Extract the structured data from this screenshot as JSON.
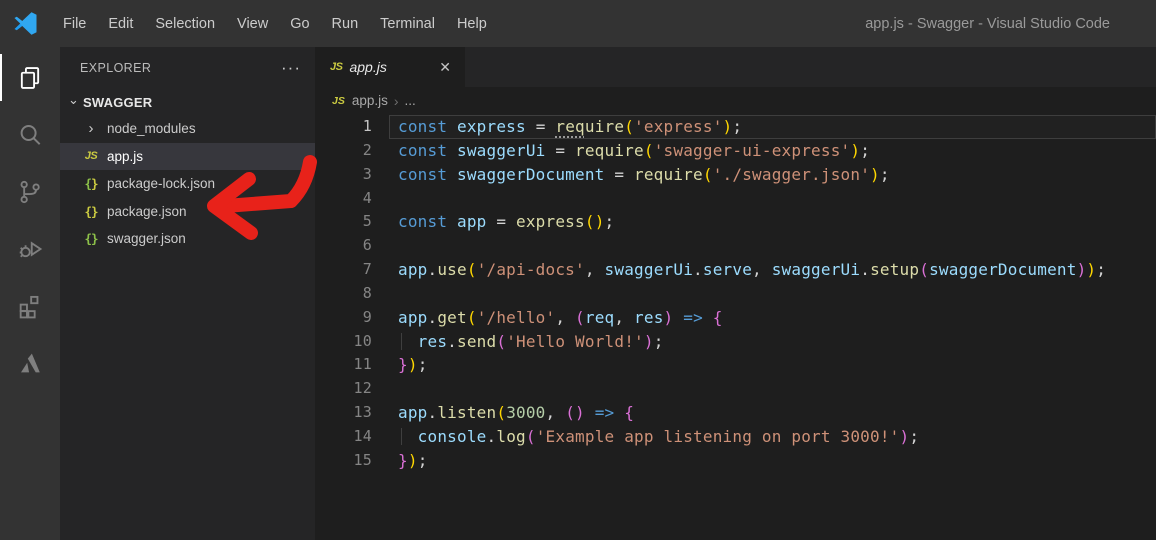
{
  "colors": {
    "titlebar_bg": "#333333",
    "activitybar_bg": "#333333",
    "sidebar_bg": "#252526",
    "editor_bg": "#1e1e1e",
    "tab_strip_bg": "#252526",
    "selected_row_bg": "#37373d",
    "logo_blue": "#1f9cf0",
    "arrow_red": "#e8221a",
    "syntax": {
      "keyword": "#569cd6",
      "variable": "#9cdcfe",
      "function": "#dcdcaa",
      "string": "#ce9178",
      "number": "#b5cea8",
      "plain": "#d4d4d4",
      "bracket1": "#ffd700",
      "bracket2": "#da70d6"
    }
  },
  "title_bar": {
    "menu_items": [
      "File",
      "Edit",
      "Selection",
      "View",
      "Go",
      "Run",
      "Terminal",
      "Help"
    ],
    "window_title": "app.js - Swagger - Visual Studio Code"
  },
  "activity_bar": {
    "icons": [
      {
        "name": "explorer",
        "active": true
      },
      {
        "name": "search",
        "active": false
      },
      {
        "name": "source-control",
        "active": false
      },
      {
        "name": "run-debug",
        "active": false
      },
      {
        "name": "extensions",
        "active": false
      },
      {
        "name": "azure",
        "active": false
      }
    ]
  },
  "sidebar": {
    "header": "EXPLORER",
    "header_actions": "···",
    "section": {
      "chevron": "⌄",
      "label": "SWAGGER"
    },
    "files": [
      {
        "icon": "chevron",
        "label": "node_modules",
        "selected": false
      },
      {
        "icon": "js",
        "icon_text": "JS",
        "label": "app.js",
        "selected": true
      },
      {
        "icon": "braces",
        "open_color": "#8dc149",
        "close_color": "#cbcb41",
        "label": "package-lock.json",
        "selected": false
      },
      {
        "icon": "braces",
        "open_color": "#cbcb41",
        "close_color": "#cbcb41",
        "label": "package.json",
        "selected": false
      },
      {
        "icon": "braces",
        "open_color": "#8dc149",
        "close_color": "#8dc149",
        "label": "swagger.json",
        "selected": false
      }
    ]
  },
  "annotation": {
    "type": "red-arrow",
    "points_at": "app.js",
    "color": "#e8221a"
  },
  "editor": {
    "tab": {
      "icon_text": "JS",
      "label": "app.js",
      "close": "✕"
    },
    "breadcrumb": {
      "icon_text": "JS",
      "file": "app.js",
      "separator": "›",
      "rest": "..."
    }
  },
  "code": {
    "current_line": 1,
    "lines": [
      {
        "num": 1,
        "tokens": [
          [
            "kw",
            "const"
          ],
          [
            "pl",
            " "
          ],
          [
            "var",
            "express"
          ],
          [
            "pl",
            " = "
          ],
          [
            "fnd",
            "req"
          ],
          [
            "fn",
            "uire"
          ],
          [
            "b1",
            "("
          ],
          [
            "str",
            "'express'"
          ],
          [
            "b1",
            ")"
          ],
          [
            "pl",
            ";"
          ]
        ]
      },
      {
        "num": 2,
        "tokens": [
          [
            "kw",
            "const"
          ],
          [
            "pl",
            " "
          ],
          [
            "var",
            "swaggerUi"
          ],
          [
            "pl",
            " = "
          ],
          [
            "fn",
            "require"
          ],
          [
            "b1",
            "("
          ],
          [
            "str",
            "'swagger-ui-express'"
          ],
          [
            "b1",
            ")"
          ],
          [
            "pl",
            ";"
          ]
        ]
      },
      {
        "num": 3,
        "tokens": [
          [
            "kw",
            "const"
          ],
          [
            "pl",
            " "
          ],
          [
            "var",
            "swaggerDocument"
          ],
          [
            "pl",
            " = "
          ],
          [
            "fn",
            "require"
          ],
          [
            "b1",
            "("
          ],
          [
            "str",
            "'./swagger.json'"
          ],
          [
            "b1",
            ")"
          ],
          [
            "pl",
            ";"
          ]
        ]
      },
      {
        "num": 4,
        "tokens": []
      },
      {
        "num": 5,
        "tokens": [
          [
            "kw",
            "const"
          ],
          [
            "pl",
            " "
          ],
          [
            "var",
            "app"
          ],
          [
            "pl",
            " = "
          ],
          [
            "fn",
            "express"
          ],
          [
            "b1",
            "()"
          ],
          [
            "pl",
            ";"
          ]
        ]
      },
      {
        "num": 6,
        "tokens": []
      },
      {
        "num": 7,
        "tokens": [
          [
            "var",
            "app"
          ],
          [
            "pl",
            "."
          ],
          [
            "fn",
            "use"
          ],
          [
            "b1",
            "("
          ],
          [
            "str",
            "'/api-docs'"
          ],
          [
            "pl",
            ", "
          ],
          [
            "var",
            "swaggerUi"
          ],
          [
            "pl",
            "."
          ],
          [
            "var",
            "serve"
          ],
          [
            "pl",
            ", "
          ],
          [
            "var",
            "swaggerUi"
          ],
          [
            "pl",
            "."
          ],
          [
            "fn",
            "setup"
          ],
          [
            "b2",
            "("
          ],
          [
            "var",
            "swaggerDocument"
          ],
          [
            "b2",
            ")"
          ],
          [
            "b1",
            ")"
          ],
          [
            "pl",
            ";"
          ]
        ]
      },
      {
        "num": 8,
        "tokens": []
      },
      {
        "num": 9,
        "tokens": [
          [
            "var",
            "app"
          ],
          [
            "pl",
            "."
          ],
          [
            "fn",
            "get"
          ],
          [
            "b1",
            "("
          ],
          [
            "str",
            "'/hello'"
          ],
          [
            "pl",
            ", "
          ],
          [
            "b2",
            "("
          ],
          [
            "var",
            "req"
          ],
          [
            "pl",
            ", "
          ],
          [
            "var",
            "res"
          ],
          [
            "b2",
            ")"
          ],
          [
            "pl",
            " "
          ],
          [
            "kw",
            "=>"
          ],
          [
            "pl",
            " "
          ],
          [
            "b2",
            "{"
          ]
        ]
      },
      {
        "num": 10,
        "tokens": [
          [
            "ind",
            "  "
          ],
          [
            "var",
            "res"
          ],
          [
            "pl",
            "."
          ],
          [
            "fn",
            "send"
          ],
          [
            "b2",
            "("
          ],
          [
            "str",
            "'Hello World!'"
          ],
          [
            "b2",
            ")"
          ],
          [
            "pl",
            ";"
          ]
        ]
      },
      {
        "num": 11,
        "tokens": [
          [
            "b2",
            "}"
          ],
          [
            "b1",
            ")"
          ],
          [
            "pl",
            ";"
          ]
        ]
      },
      {
        "num": 12,
        "tokens": []
      },
      {
        "num": 13,
        "tokens": [
          [
            "var",
            "app"
          ],
          [
            "pl",
            "."
          ],
          [
            "fn",
            "listen"
          ],
          [
            "b1",
            "("
          ],
          [
            "num",
            "3000"
          ],
          [
            "pl",
            ", "
          ],
          [
            "b2",
            "()"
          ],
          [
            "pl",
            " "
          ],
          [
            "kw",
            "=>"
          ],
          [
            "pl",
            " "
          ],
          [
            "b2",
            "{"
          ]
        ]
      },
      {
        "num": 14,
        "tokens": [
          [
            "ind",
            "  "
          ],
          [
            "var",
            "console"
          ],
          [
            "pl",
            "."
          ],
          [
            "fn",
            "log"
          ],
          [
            "b2",
            "("
          ],
          [
            "str",
            "'Example app listening on port 3000!'"
          ],
          [
            "b2",
            ")"
          ],
          [
            "pl",
            ";"
          ]
        ]
      },
      {
        "num": 15,
        "tokens": [
          [
            "b2",
            "}"
          ],
          [
            "b1",
            ")"
          ],
          [
            "pl",
            ";"
          ]
        ]
      }
    ]
  }
}
